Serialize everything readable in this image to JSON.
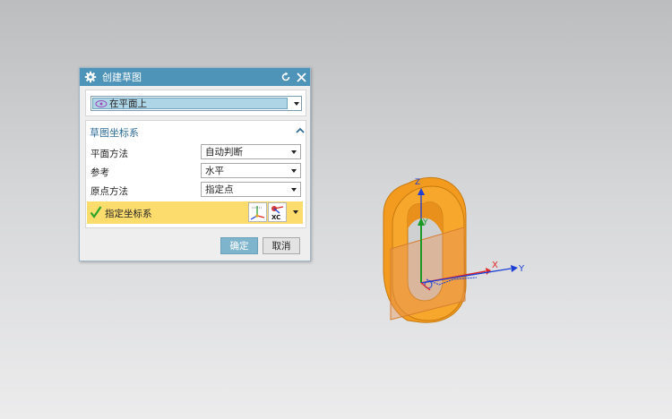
{
  "dialog": {
    "title": "创建草图",
    "sketch_type": "在平面上",
    "section_title": "草图坐标系",
    "rows": [
      {
        "label": "平面方法",
        "value": "自动判断"
      },
      {
        "label": "参考",
        "value": "水平"
      },
      {
        "label": "原点方法",
        "value": "指定点"
      }
    ],
    "specify_csys_label": "指定坐标系",
    "csys_button_caption": "XC",
    "ok_label": "确定",
    "cancel_label": "取消"
  },
  "viewport": {
    "axis_labels": {
      "x": "X",
      "y": "Y",
      "z": "Z",
      "green_y": "Y"
    },
    "part_color": "#f5a623",
    "part_edge_color": "#c77a10"
  },
  "colors": {
    "titlebar": "#4e93b8",
    "selection": "#aed5e6",
    "highlight_row": "#fcdc6d",
    "ok_button": "#7fb4cd"
  }
}
